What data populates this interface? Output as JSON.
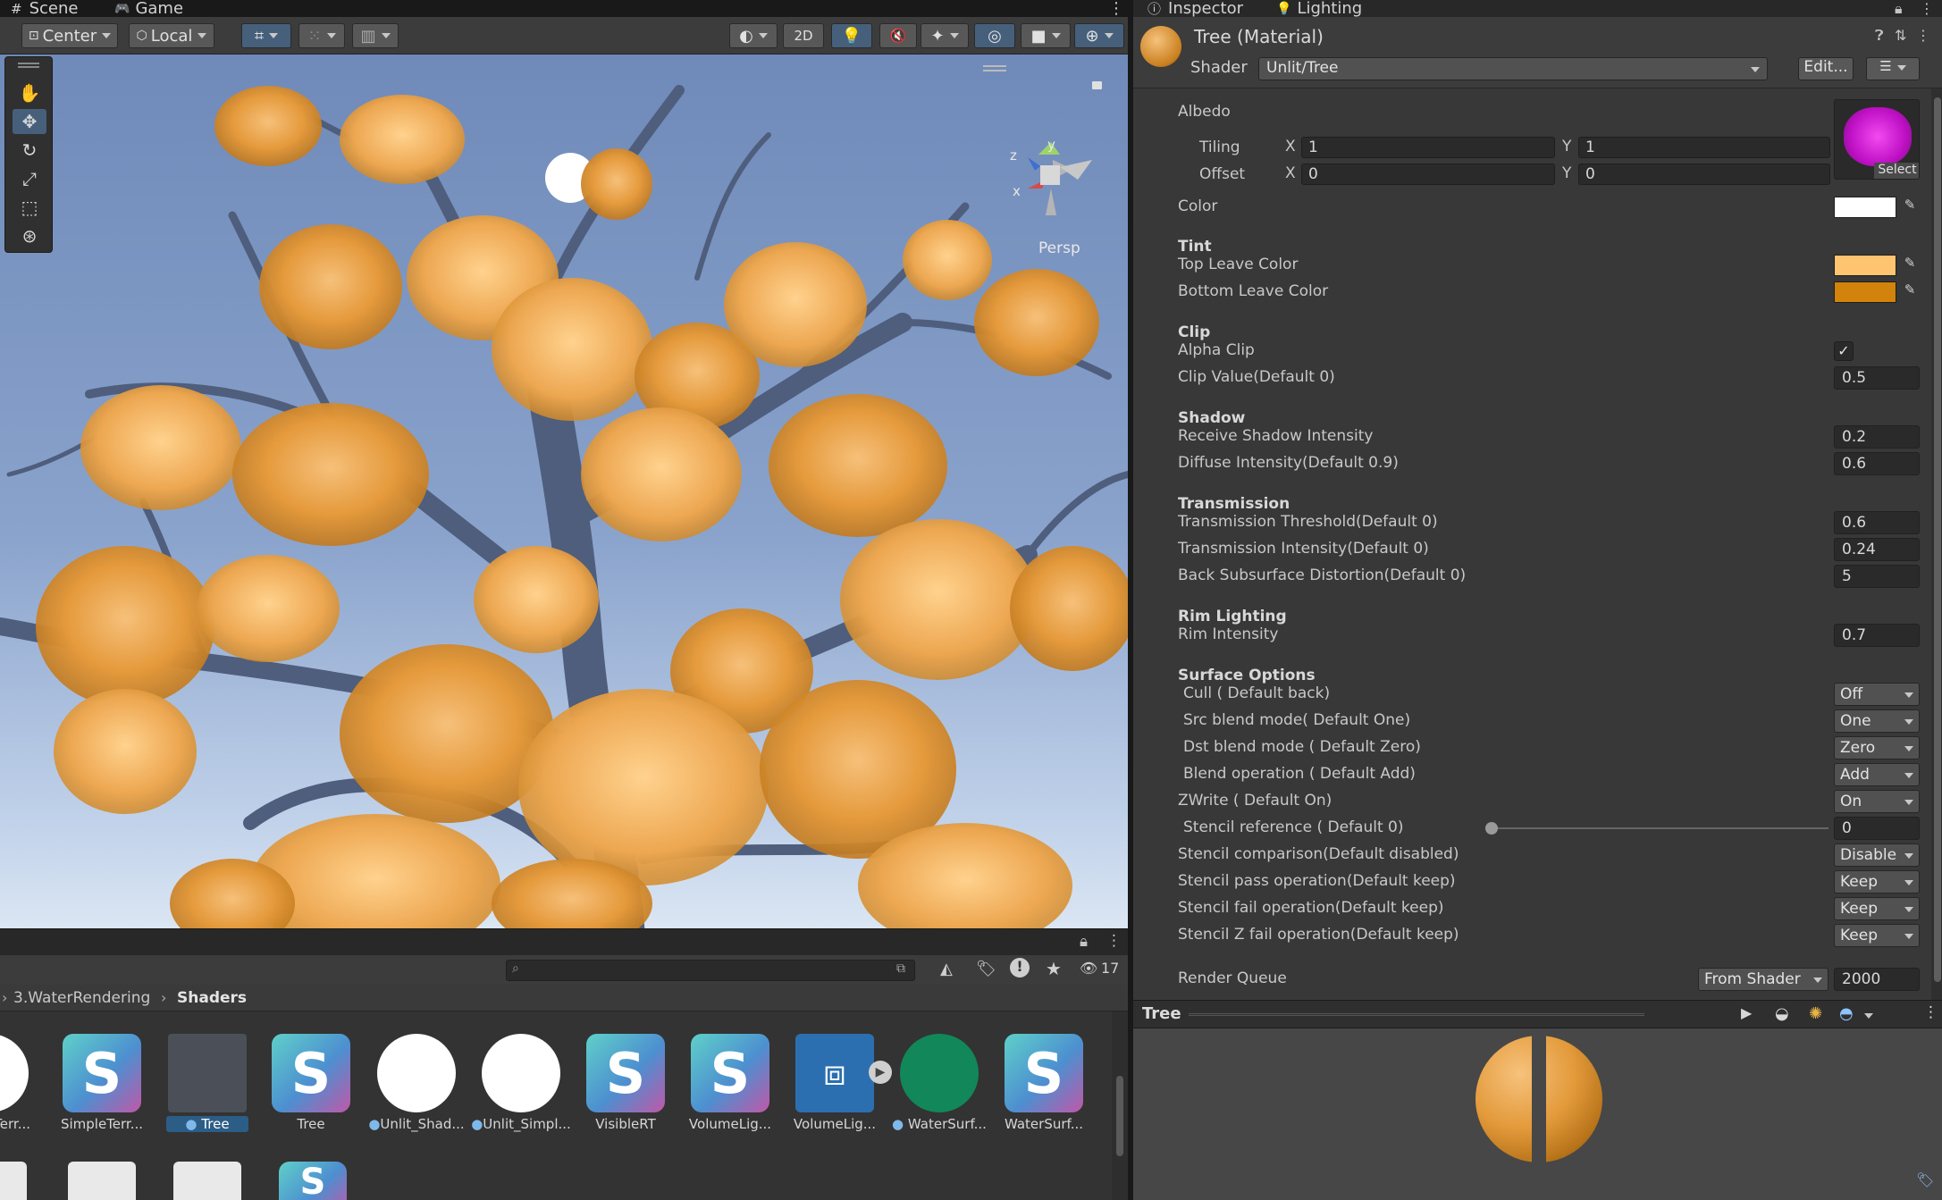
{
  "scene": {
    "tabs": [
      {
        "label": "Scene"
      },
      {
        "label": "Game"
      }
    ],
    "toolbar": {
      "pivot_mode": "Center",
      "pivot_rotation": "Local",
      "mode_2d": "2D"
    },
    "gizmo": {
      "projection": "Persp",
      "axis_z": "z",
      "axis_y": "y",
      "axis_x": "x"
    }
  },
  "project": {
    "hidden_count": "17",
    "breadcrumb": {
      "parent": "3.WaterRendering",
      "current": "Shaders"
    },
    "assets": [
      {
        "label": "SimpleTerr..."
      },
      {
        "label": "SimpleTerr..."
      },
      {
        "label": "Tree"
      },
      {
        "label": "Tree"
      },
      {
        "label": "Unlit_Shad..."
      },
      {
        "label": "Unlit_Simpl..."
      },
      {
        "label": "VisibleRT"
      },
      {
        "label": "VolumeLig..."
      },
      {
        "label": "VolumeLig..."
      },
      {
        "label": "WaterSurf..."
      },
      {
        "label": "WaterSurf..."
      }
    ],
    "row2_badge": "S"
  },
  "inspector": {
    "tabs": [
      {
        "label": "Inspector"
      },
      {
        "label": "Lighting"
      }
    ],
    "material_title": "Tree (Material)",
    "shader_label": "Shader",
    "shader_value": "Unlit/Tree",
    "edit_label": "Edit...",
    "albedo_label": "Albedo",
    "select_label": "Select",
    "tiling": {
      "label": "Tiling",
      "x_label": "X",
      "x": "1",
      "y_label": "Y",
      "y": "1"
    },
    "offset": {
      "label": "Offset",
      "x_label": "X",
      "x": "0",
      "y_label": "Y",
      "y": "0"
    },
    "color_label": "Color",
    "tint": {
      "title": "Tint",
      "top_label": "Top Leave Color",
      "top_color": "#ffc470",
      "bottom_label": "Bottom Leave Color",
      "bottom_color": "#d1830c"
    },
    "clip": {
      "title": "Clip",
      "alpha_clip_label": "Alpha Clip",
      "clip_value_label": "Clip Value(Default 0)",
      "clip_value": "0.5"
    },
    "shadow": {
      "title": "Shadow",
      "receive_label": "Receive Shadow Intensity",
      "receive_value": "0.2",
      "diffuse_label": "Diffuse Intensity(Default 0.9)",
      "diffuse_value": "0.6"
    },
    "transmission": {
      "title": "Transmission",
      "threshold_label": "Transmission Threshold(Default 0)",
      "threshold_value": "0.6",
      "intensity_label": "Transmission Intensity(Default 0)",
      "intensity_value": "0.24",
      "distortion_label": "Back Subsurface Distortion(Default 0)",
      "distortion_value": "5"
    },
    "rim": {
      "title": "Rim Lighting",
      "intensity_label": "Rim Intensity",
      "intensity_value": "0.7"
    },
    "surface": {
      "title": "Surface Options",
      "cull_label": "Cull ( Default back)",
      "cull_value": "Off",
      "src_label": "Src blend mode( Default One)",
      "src_value": "One",
      "dst_label": "Dst blend mode ( Default Zero)",
      "dst_value": "Zero",
      "blendop_label": "Blend operation ( Default Add)",
      "blendop_value": "Add",
      "zwrite_label": "ZWrite ( Default On)",
      "zwrite_value": "On",
      "stencil_ref_label": "Stencil reference ( Default 0)",
      "stencil_ref_value": "0",
      "stencil_comp_label": "Stencil comparison(Default disabled)",
      "stencil_comp_value": "Disable",
      "stencil_pass_label": "Stencil pass operation(Default keep)",
      "stencil_pass_value": "Keep",
      "stencil_fail_label": "Stencil fail operation(Default keep)",
      "stencil_fail_value": "Keep",
      "stencil_zfail_label": "Stencil Z fail operation(Default keep)",
      "stencil_zfail_value": "Keep"
    },
    "render_queue": {
      "label": "Render Queue",
      "mode": "From Shader",
      "value": "2000"
    },
    "preview_title": "Tree"
  }
}
